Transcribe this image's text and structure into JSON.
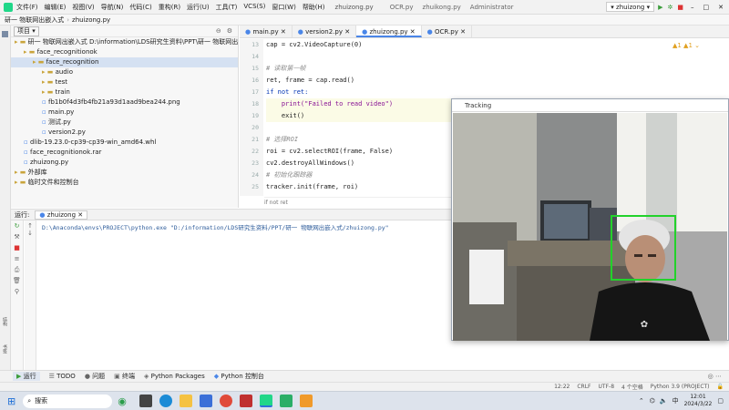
{
  "titlebar": {
    "project": "研一 物联网出嵌入式",
    "path": "zhuizong.py",
    "menu": [
      "文件(F)",
      "编辑(E)",
      "视图(V)",
      "导航(N)",
      "代码(C)",
      "重构(R)",
      "运行(U)",
      "工具(T)",
      "VCS(S)",
      "窗口(W)",
      "帮助(H)"
    ],
    "tabs": [
      "OCR.py",
      "zhuikong.py",
      "Administrator"
    ],
    "run_config": "zhuizong"
  },
  "nav": {
    "crumb": "研一 物联网出嵌入式",
    "file": "zhuizong.py"
  },
  "project_panel": {
    "label": "项目",
    "items": [
      {
        "text": "研一 物联网出嵌入式  D:\\information\\LDS研究生资料\\PPT\\研一 物联网出嵌入式",
        "indent": 0
      },
      {
        "text": "face_recognitionok",
        "indent": 1
      },
      {
        "text": "face_recognition",
        "indent": 2
      },
      {
        "text": "audio",
        "indent": 3
      },
      {
        "text": "test",
        "indent": 3
      },
      {
        "text": "train",
        "indent": 3
      },
      {
        "text": "fb1b0f4d3fb4fb21a93d1aad9bea244.png",
        "indent": 3
      },
      {
        "text": "main.py",
        "indent": 3
      },
      {
        "text": "测试.py",
        "indent": 3
      },
      {
        "text": "version2.py",
        "indent": 3
      },
      {
        "text": "dlib-19.23.0-cp39-cp39-win_amd64.whl",
        "indent": 1
      },
      {
        "text": "face_recognitionok.rar",
        "indent": 1
      },
      {
        "text": "zhuizong.py",
        "indent": 1
      },
      {
        "text": "外部库",
        "indent": 0
      },
      {
        "text": "临时文件和控制台",
        "indent": 0
      }
    ]
  },
  "editor_tabs": [
    {
      "label": "main.py",
      "active": false
    },
    {
      "label": "version2.py",
      "active": false
    },
    {
      "label": "zhuizong.py",
      "active": true
    },
    {
      "label": "OCR.py",
      "active": false
    }
  ],
  "line_numbers": [
    "13",
    "14",
    "15",
    "16",
    "17",
    "18",
    "19",
    "20",
    "21",
    "22",
    "23",
    "24",
    "25"
  ],
  "code_lines": [
    {
      "t": "cap = cv2.VideoCapture(0)",
      "c": "n"
    },
    {
      "t": "",
      "c": "n"
    },
    {
      "t": "# 读取第一帧",
      "c": "cm"
    },
    {
      "t": "ret, frame = cap.read()",
      "c": "n"
    },
    {
      "t": "if not ret:",
      "c": "kw"
    },
    {
      "t": "    print(\"Failed to read video\")",
      "c": "str"
    },
    {
      "t": "    exit()",
      "c": "n"
    },
    {
      "t": "",
      "c": "n"
    },
    {
      "t": "# 选择ROI",
      "c": "cm"
    },
    {
      "t": "roi = cv2.selectROI(frame, False)",
      "c": "n"
    },
    {
      "t": "cv2.destroyAllWindows()",
      "c": "n"
    },
    {
      "t": "# 初始化跟踪器",
      "c": "cm"
    },
    {
      "t": "tracker.init(frame, roi)",
      "c": "n"
    }
  ],
  "editor_breadcrumb": "if not ret",
  "run_panel": {
    "label": "运行:",
    "tab": "zhuizong",
    "command": "D:\\Anaconda\\envs\\PROJECT\\python.exe \"D:/information/LDS研究生资料/PPT/研一 物联网出嵌入式/zhuizong.py\""
  },
  "bottom_tabs": [
    "运行",
    "TODO",
    "问题",
    "终端",
    "Python Packages",
    "Python 控制台"
  ],
  "statusbar": {
    "position": "12:22",
    "eol": "CRLF",
    "encoding": "UTF-8",
    "indent": "4 个空格",
    "interpreter": "Python 3.9 (PROJECT)"
  },
  "tracking_window": {
    "title": "Tracking"
  },
  "taskbar": {
    "search": "搜索",
    "time": "12:01",
    "date": "2024/3/22"
  },
  "colors": {
    "accent": "#4a86e8",
    "tracking_box": "#22d22b"
  }
}
